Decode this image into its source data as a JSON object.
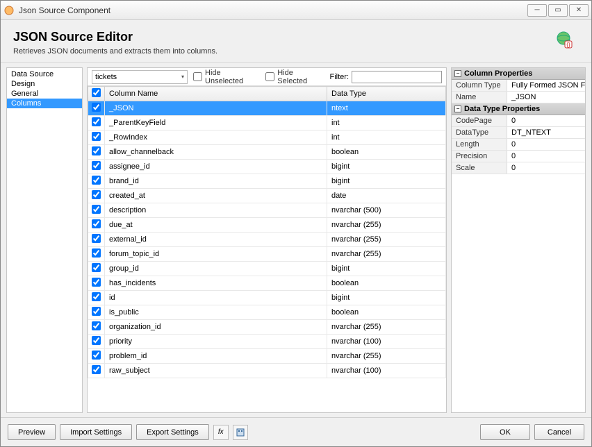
{
  "window": {
    "title": "Json Source Component"
  },
  "header": {
    "title": "JSON Source Editor",
    "subtitle": "Retrieves JSON documents and extracts them into columns."
  },
  "sidebar": {
    "items": [
      {
        "label": "Data Source",
        "selected": false
      },
      {
        "label": "Design",
        "selected": false
      },
      {
        "label": "General",
        "selected": false
      },
      {
        "label": "Columns",
        "selected": true
      }
    ]
  },
  "toolbar": {
    "combo_value": "tickets",
    "hide_unselected": "Hide Unselected",
    "hide_selected": "Hide Selected",
    "filter_label": "Filter:"
  },
  "grid": {
    "headers": {
      "col1": "Column Name",
      "col2": "Data Type"
    },
    "rows": [
      {
        "checked": true,
        "name": "_JSON",
        "type": "ntext",
        "selected": true
      },
      {
        "checked": true,
        "name": "_ParentKeyField",
        "type": "int",
        "selected": false
      },
      {
        "checked": true,
        "name": "_RowIndex",
        "type": "int",
        "selected": false
      },
      {
        "checked": true,
        "name": "allow_channelback",
        "type": "boolean",
        "selected": false
      },
      {
        "checked": true,
        "name": "assignee_id",
        "type": "bigint",
        "selected": false
      },
      {
        "checked": true,
        "name": "brand_id",
        "type": "bigint",
        "selected": false
      },
      {
        "checked": true,
        "name": "created_at",
        "type": "date",
        "selected": false
      },
      {
        "checked": true,
        "name": "description",
        "type": "nvarchar (500)",
        "selected": false
      },
      {
        "checked": true,
        "name": "due_at",
        "type": "nvarchar (255)",
        "selected": false
      },
      {
        "checked": true,
        "name": "external_id",
        "type": "nvarchar (255)",
        "selected": false
      },
      {
        "checked": true,
        "name": "forum_topic_id",
        "type": "nvarchar (255)",
        "selected": false
      },
      {
        "checked": true,
        "name": "group_id",
        "type": "bigint",
        "selected": false
      },
      {
        "checked": true,
        "name": "has_incidents",
        "type": "boolean",
        "selected": false
      },
      {
        "checked": true,
        "name": "id",
        "type": "bigint",
        "selected": false
      },
      {
        "checked": true,
        "name": "is_public",
        "type": "boolean",
        "selected": false
      },
      {
        "checked": true,
        "name": "organization_id",
        "type": "nvarchar (255)",
        "selected": false
      },
      {
        "checked": true,
        "name": "priority",
        "type": "nvarchar (100)",
        "selected": false
      },
      {
        "checked": true,
        "name": "problem_id",
        "type": "nvarchar (255)",
        "selected": false
      },
      {
        "checked": true,
        "name": "raw_subject",
        "type": "nvarchar (100)",
        "selected": false
      }
    ]
  },
  "props": {
    "section1": "Column Properties",
    "column_type": {
      "label": "Column Type",
      "value": "Fully Formed JSON Fie"
    },
    "name": {
      "label": "Name",
      "value": "_JSON"
    },
    "section2": "Data Type Properties",
    "codepage": {
      "label": "CodePage",
      "value": "0"
    },
    "datatype": {
      "label": "DataType",
      "value": "DT_NTEXT"
    },
    "length": {
      "label": "Length",
      "value": "0"
    },
    "precision": {
      "label": "Precision",
      "value": "0"
    },
    "scale": {
      "label": "Scale",
      "value": "0"
    }
  },
  "footer": {
    "preview": "Preview",
    "import": "Import Settings",
    "export": "Export Settings",
    "ok": "OK",
    "cancel": "Cancel"
  }
}
